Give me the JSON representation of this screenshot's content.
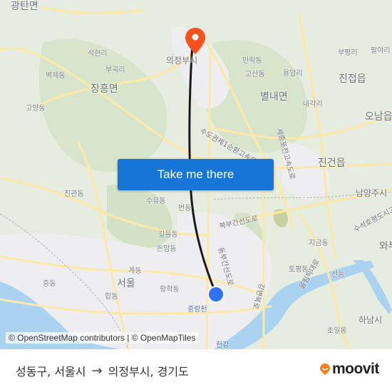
{
  "map": {
    "places": [
      {
        "name": "광탄면",
        "kind": "big"
      },
      {
        "name": "석현리",
        "kind": "small"
      },
      {
        "name": "벽제동",
        "kind": "small"
      },
      {
        "name": "부곡리",
        "kind": "small"
      },
      {
        "name": "장흥면",
        "kind": "big"
      },
      {
        "name": "고양동",
        "kind": "small"
      },
      {
        "name": "의정부시",
        "kind": "mid"
      },
      {
        "name": "민락동",
        "kind": "small"
      },
      {
        "name": "고산동",
        "kind": "small"
      },
      {
        "name": "용암리",
        "kind": "small"
      },
      {
        "name": "부평리",
        "kind": "small"
      },
      {
        "name": "팔야리",
        "kind": "small"
      },
      {
        "name": "진접읍",
        "kind": "big"
      },
      {
        "name": "별내면",
        "kind": "big"
      },
      {
        "name": "내각리",
        "kind": "small"
      },
      {
        "name": "오남읍",
        "kind": "big"
      },
      {
        "name": "진건읍",
        "kind": "big"
      },
      {
        "name": "남양주시",
        "kind": "mid"
      },
      {
        "name": "진관동",
        "kind": "small"
      },
      {
        "name": "수유동",
        "kind": "small"
      },
      {
        "name": "번동",
        "kind": "small"
      },
      {
        "name": "길음동",
        "kind": "small"
      },
      {
        "name": "돈암동",
        "kind": "small"
      },
      {
        "name": "계동",
        "kind": "small"
      },
      {
        "name": "중동",
        "kind": "small"
      },
      {
        "name": "서울",
        "kind": "big"
      },
      {
        "name": "황학동",
        "kind": "small"
      },
      {
        "name": "합동",
        "kind": "small"
      },
      {
        "name": "중랑천",
        "kind": "water"
      },
      {
        "name": "지금동",
        "kind": "small"
      },
      {
        "name": "토평동",
        "kind": "small"
      },
      {
        "name": "선동",
        "kind": "small"
      },
      {
        "name": "와부",
        "kind": "big"
      },
      {
        "name": "하남시",
        "kind": "mid"
      },
      {
        "name": "초일동",
        "kind": "small"
      },
      {
        "name": "한강",
        "kind": "water"
      }
    ],
    "roads": [
      {
        "name": "수도권제1순환고속도로"
      },
      {
        "name": "세종포천고속도로"
      },
      {
        "name": "북부간선도로"
      },
      {
        "name": "동부간선도로"
      },
      {
        "name": "강변북로"
      },
      {
        "name": "올림픽대로"
      },
      {
        "name": "수석호평도시고속도로"
      }
    ],
    "cta_label": "Take me there",
    "attribution": "© OpenStreetMap contributors | © OpenMapTiles",
    "colors": {
      "route": "#1a1a1a",
      "origin": "#2d72f2",
      "destination": "#f5521f",
      "cta": "#1875d8"
    }
  },
  "footer": {
    "origin": "성동구, 서울시",
    "arrow": "→",
    "destination": "의정부시, 경기도",
    "brand": "moovit",
    "brand_color": "#f5821f"
  }
}
